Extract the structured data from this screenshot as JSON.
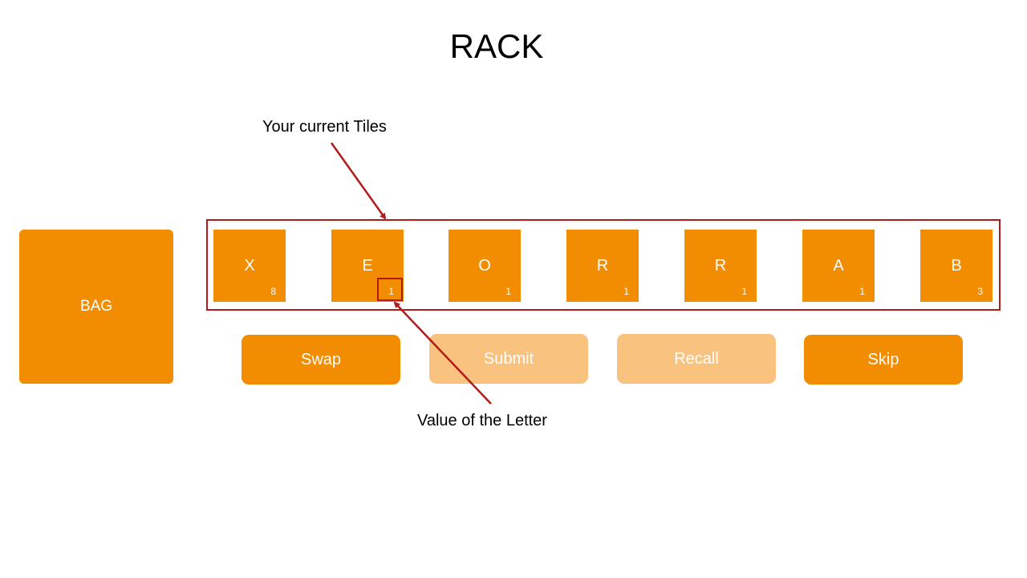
{
  "title": "RACK",
  "bag": {
    "label": "BAG"
  },
  "rack": {
    "tiles": [
      {
        "letter": "X",
        "value": "8"
      },
      {
        "letter": "E",
        "value": "1"
      },
      {
        "letter": "O",
        "value": "1"
      },
      {
        "letter": "R",
        "value": "1"
      },
      {
        "letter": "R",
        "value": "1"
      },
      {
        "letter": "A",
        "value": "1"
      },
      {
        "letter": "B",
        "value": "3"
      }
    ]
  },
  "buttons": {
    "swap": "Swap",
    "submit": "Submit",
    "recall": "Recall",
    "skip": "Skip"
  },
  "annotations": {
    "tiles_note": "Your current Tiles",
    "value_note": "Value of the Letter"
  },
  "colors": {
    "tile": "#f28c00",
    "button_disabled": "#f9c27e",
    "annotation": "#b31b1b"
  }
}
